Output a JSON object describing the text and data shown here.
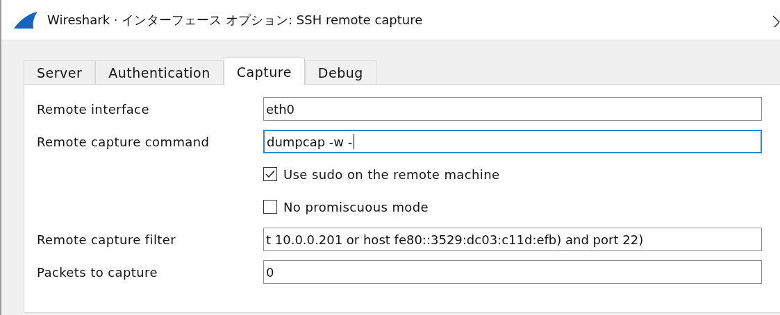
{
  "window": {
    "title": "Wireshark · インターフェース オプション: SSH remote capture"
  },
  "tabs": [
    {
      "label": "Server",
      "selected": false
    },
    {
      "label": "Authentication",
      "selected": false
    },
    {
      "label": "Capture",
      "selected": true
    },
    {
      "label": "Debug",
      "selected": false
    }
  ],
  "rows": [
    {
      "kind": "text",
      "label": "Remote interface",
      "value": "eth0",
      "focused": false
    },
    {
      "kind": "text",
      "label": "Remote capture command",
      "value": "dumpcap -w -",
      "focused": true
    },
    {
      "kind": "checkbox",
      "label": "Use sudo on the remote machine",
      "checked": true
    },
    {
      "kind": "checkbox",
      "label": "No promiscuous mode",
      "checked": false
    },
    {
      "kind": "text",
      "label": "Remote capture filter",
      "value": "t 10.0.0.201 or host fe80::3529:dc03:c11d:efb) and port 22)",
      "focused": false
    },
    {
      "kind": "text",
      "label": "Packets to capture",
      "value": "0",
      "focused": false
    }
  ]
}
